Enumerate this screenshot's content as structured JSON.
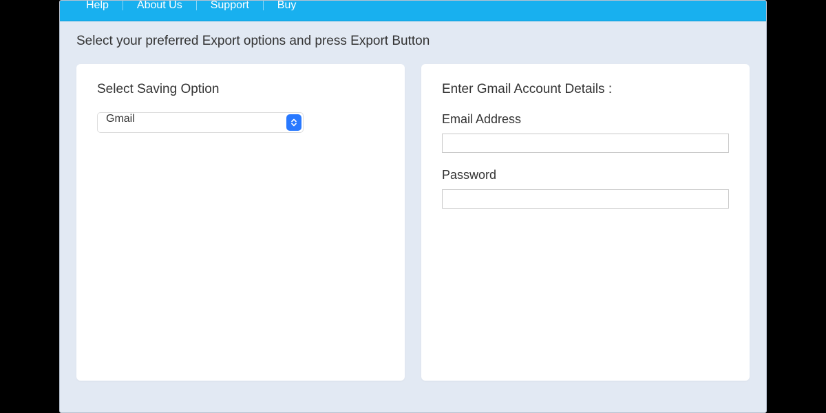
{
  "menu": {
    "items": [
      "Help",
      "About Us",
      "Support",
      "Buy"
    ]
  },
  "instruction": "Select your preferred Export options and press Export Button",
  "leftPanel": {
    "title": "Select Saving Option",
    "select": {
      "value": "Gmail"
    }
  },
  "rightPanel": {
    "title": "Enter Gmail Account Details :",
    "emailLabel": "Email Address",
    "emailValue": "",
    "passwordLabel": "Password",
    "passwordValue": ""
  }
}
